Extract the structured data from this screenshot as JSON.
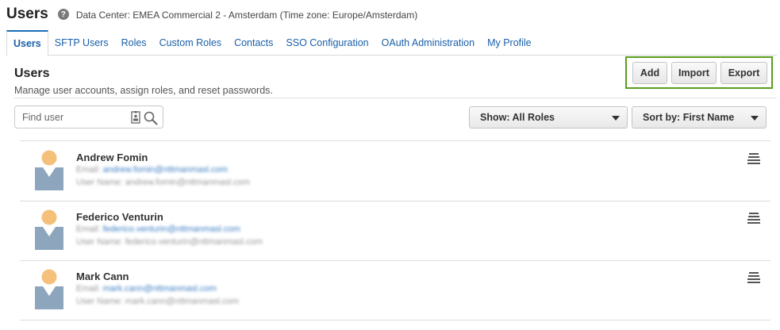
{
  "header": {
    "title": "Users",
    "help_icon": "question-icon",
    "data_center": "Data Center: EMEA Commercial 2 - Amsterdam (Time zone: Europe/Amsterdam)"
  },
  "tabs": [
    {
      "label": "Users",
      "active": true
    },
    {
      "label": "SFTP Users"
    },
    {
      "label": "Roles"
    },
    {
      "label": "Custom Roles"
    },
    {
      "label": "Contacts"
    },
    {
      "label": "SSO Configuration"
    },
    {
      "label": "OAuth Administration"
    },
    {
      "label": "My Profile"
    }
  ],
  "section": {
    "title": "Users",
    "description": "Manage user accounts, assign roles, and reset passwords."
  },
  "actions": {
    "add": "Add",
    "import": "Import",
    "export": "Export",
    "highlight_color": "#5a9e1e"
  },
  "search": {
    "placeholder": "Find user",
    "value": ""
  },
  "filters": {
    "show": "Show: All Roles",
    "sort": "Sort by: First Name"
  },
  "users": [
    {
      "name": "Andrew Fomin",
      "email_label": "Email:",
      "email": "andrew.fomin@nttmanmasl.com",
      "username_label": "User Name:",
      "username": "andrew.fomin@nttmanmasl.com"
    },
    {
      "name": "Federico Venturin",
      "email_label": "Email:",
      "email": "federico.venturin@nttmanmasl.com",
      "username_label": "User Name:",
      "username": "federico.venturin@nttmanmasl.com"
    },
    {
      "name": "Mark Cann",
      "email_label": "Email:",
      "email": "mark.cann@nttmanmasl.com",
      "username_label": "User Name:",
      "username": "mark.cann@nttmanmasl.com"
    }
  ],
  "colors": {
    "link": "#1a5fa8",
    "avatar_head": "#f5c07a",
    "avatar_body": "#8ea6bd"
  }
}
